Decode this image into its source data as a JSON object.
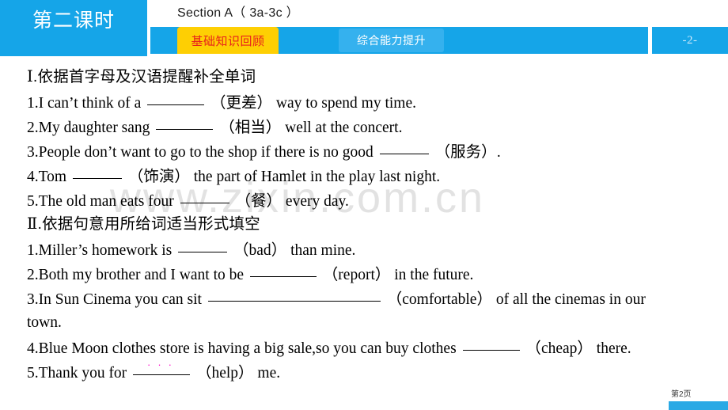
{
  "header": {
    "lesson_badge": "第二课时",
    "section_title": "Section A（ 3a-3c ）",
    "tab_basic": "基础知识回顾",
    "tab_advanced": "综合能力提升",
    "page_chip": "-2-",
    "colors": {
      "brand_blue": "#15a5e8",
      "tab_yellow": "#fecf03",
      "tab_red_text": "#e8211c",
      "tab_light_blue": "#35b1ee"
    }
  },
  "watermark": "www.zixin.com.cn",
  "sections": [
    {
      "heading_roman": "Ⅰ",
      "heading_text": ".依据首字母及汉语提醒补全单词",
      "items": [
        {
          "num": "1.",
          "before": "I can’t think of a",
          "blank": "b-md",
          "hint_open": "（",
          "hint": "更差",
          "hint_close": "）",
          "after": "way to spend my time."
        },
        {
          "num": "2.",
          "before": "My daughter sang",
          "blank": "b-md",
          "hint_open": "（",
          "hint": "相当",
          "hint_close": "）",
          "after": "well at the concert."
        },
        {
          "num": "3.",
          "before": "People don’t want to go to the shop if there is no good",
          "blank": "b-sm",
          "hint_open": "（",
          "hint": "服务",
          "hint_close": "）.",
          "after": ""
        },
        {
          "num": "4.",
          "before": "Tom",
          "blank": "b-sm",
          "hint_open": "（",
          "hint": "饰演",
          "hint_close": "）",
          "after": "the part of Hamlet in the play last night."
        },
        {
          "num": "5.",
          "before": "The old man eats four",
          "blank": "b-sm",
          "hint_open": "（",
          "hint": "餐",
          "hint_close": "）",
          "after": "every day."
        }
      ]
    },
    {
      "heading_roman": "Ⅱ",
      "heading_text": ".依据句意用所给词适当形式填空",
      "items": [
        {
          "num": "1.",
          "before": "Miller’s homework is",
          "blank": "b-sm",
          "hint_open": "（",
          "hint": "bad",
          "hint_close": "）",
          "after": "than mine."
        },
        {
          "num": "2.",
          "before": "Both my brother and I want to be",
          "blank": "b-lg",
          "hint_open": "（",
          "hint": "report",
          "hint_close": "）",
          "after": "in the future."
        },
        {
          "num": "3.",
          "before": "In Sun Cinema you can sit",
          "blank": "b-xxl",
          "hint_open": "（",
          "hint": "comfortable",
          "hint_close": "）",
          "after": "of all the cinemas in our",
          "wrap": "town."
        },
        {
          "num": "4.",
          "before": "Blue Moon clothes store is having a big sale,so you can buy clothes",
          "blank": "b-md",
          "hint_open": "（",
          "hint": "cheap",
          "hint_close": "）",
          "after": "there."
        },
        {
          "num": "5.",
          "before": "Thank you for",
          "blank": "b-md",
          "hint_open": "（",
          "hint": "help",
          "hint_close": "）",
          "after": "me."
        }
      ]
    }
  ],
  "footer": {
    "page_label": "第2页"
  }
}
